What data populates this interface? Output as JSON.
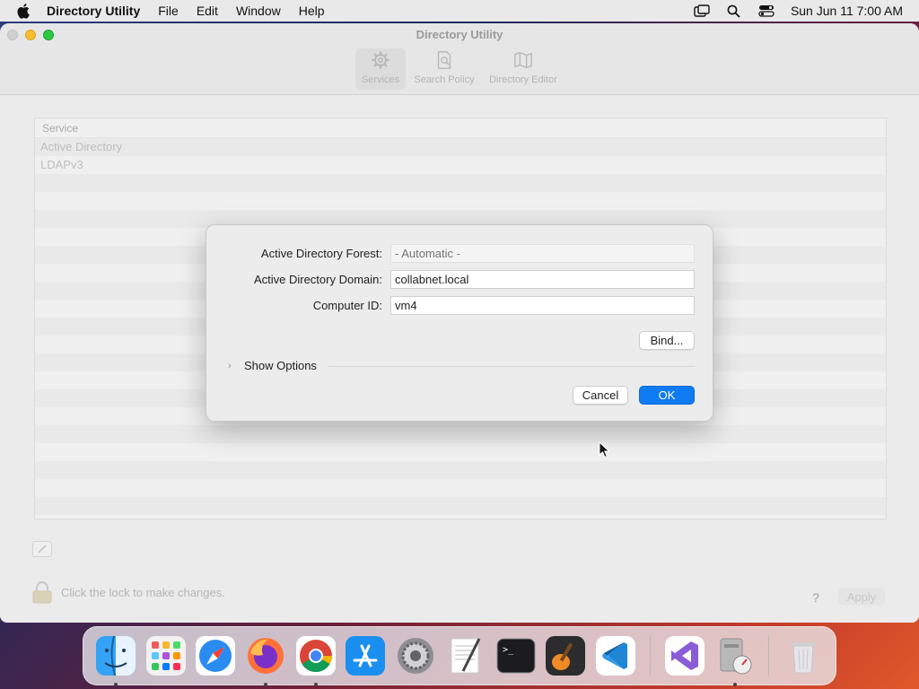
{
  "menubar": {
    "app_name": "Directory Utility",
    "menus": [
      "File",
      "Edit",
      "Window",
      "Help"
    ],
    "datetime": "Sun Jun 11  7:00 AM",
    "icons": [
      "screen-mirroring-icon",
      "spotlight-search-icon",
      "control-center-icon"
    ]
  },
  "window": {
    "title": "Directory Utility",
    "toolbar": [
      {
        "label": "Services",
        "icon": "gear-icon",
        "active": true
      },
      {
        "label": "Search Policy",
        "icon": "search-policy-icon",
        "active": false
      },
      {
        "label": "Directory Editor",
        "icon": "map-icon",
        "active": false
      }
    ],
    "table": {
      "header": "Service",
      "rows": [
        "Active Directory",
        "LDAPv3"
      ]
    },
    "lock_text": "Click the lock to make changes.",
    "help_label": "?",
    "apply_label": "Apply"
  },
  "dialog": {
    "forest_label": "Active Directory Forest:",
    "forest_placeholder": "- Automatic -",
    "domain_label": "Active Directory Domain:",
    "domain_value": "collabnet.local",
    "computer_id_label": "Computer ID:",
    "computer_id_value": "vm4",
    "bind_label": "Bind...",
    "show_options_label": "Show Options",
    "cancel_label": "Cancel",
    "ok_label": "OK"
  },
  "colors": {
    "accent": "#0f7bf2",
    "traffic_min": "#f6be2f",
    "traffic_max": "#2bc840"
  },
  "dock": {
    "items": [
      {
        "name": "finder",
        "running": true
      },
      {
        "name": "launchpad",
        "running": false
      },
      {
        "name": "safari",
        "running": false
      },
      {
        "name": "firefox",
        "running": true
      },
      {
        "name": "chrome",
        "running": true
      },
      {
        "name": "app-store",
        "running": false
      },
      {
        "name": "system-preferences",
        "running": false
      },
      {
        "name": "textedit",
        "running": false
      },
      {
        "name": "terminal",
        "running": false
      },
      {
        "name": "garageband",
        "running": false
      },
      {
        "name": "vscode",
        "running": false
      },
      {
        "name": "visual-studio",
        "running": false
      },
      {
        "name": "directory-utility",
        "running": true
      },
      {
        "name": "trash",
        "running": false
      }
    ]
  }
}
